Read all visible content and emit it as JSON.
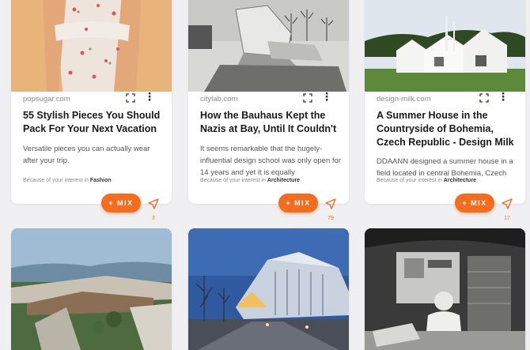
{
  "cards": [
    {
      "image": "floral-dress-photo",
      "domain": "popsugar.com",
      "title": "55 Stylish Pieces You Should Pack For Your Next Vacation",
      "description": "Versatile pieces you can actually wear after your trip.",
      "interest_prefix": "Because of your interest in",
      "interest_topic": "Fashion",
      "mix_label": "+ MIX",
      "share_count": "3"
    },
    {
      "image": "bauhaus-building-bw-photo",
      "domain": "citylab.com",
      "title": "How the Bauhaus Kept the Nazis at Bay, Until It Couldn't",
      "description": "It seems remarkable that the hugely-influential design school was only open for 14 years and yet it is equally",
      "interest_prefix": "Because of your interest in",
      "interest_topic": "Architecture",
      "mix_label": "+ MIX",
      "share_count": "79"
    },
    {
      "image": "white-house-countryside-photo",
      "domain": "design-milk.com",
      "title": "A Summer House in the Countryside of Bohemia, Czech Republic - Design Milk",
      "description": "DDAANN designed a summer house in a field located in central Bohemia, Czech",
      "interest_prefix": "Because of your interest in",
      "interest_topic": "Architecture",
      "mix_label": "+ MIX",
      "share_count": "17"
    },
    {
      "image": "housing-complex-photo"
    },
    {
      "image": "modern-museum-night-photo"
    },
    {
      "image": "architect-at-desk-bw-photo"
    }
  ],
  "colors": {
    "accent": "#f56c1f",
    "background": "#f0f0f2"
  }
}
